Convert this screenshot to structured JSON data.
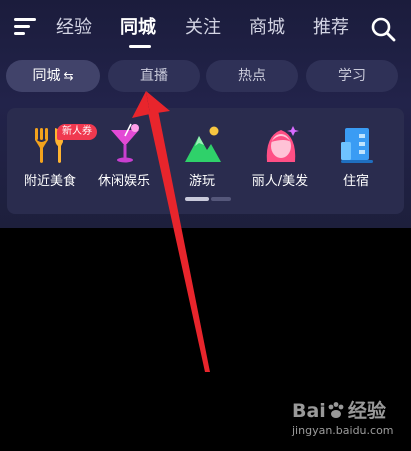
{
  "header": {
    "tabs": [
      {
        "label": "经验",
        "active": false
      },
      {
        "label": "同城",
        "active": true
      },
      {
        "label": "关注",
        "active": false
      },
      {
        "label": "商城",
        "active": false
      },
      {
        "label": "推荐",
        "active": false
      }
    ],
    "menu_icon": "hamburger-menu-icon",
    "search_icon": "search-icon"
  },
  "sub_tabs": [
    {
      "label": "同城",
      "suffix": "⇆",
      "active": true
    },
    {
      "label": "直播",
      "active": false
    },
    {
      "label": "热点",
      "active": false
    },
    {
      "label": "学习",
      "active": false
    }
  ],
  "categories": [
    {
      "label": "附近美食",
      "icon": "fork-knife-icon",
      "badge": "新人券",
      "color": "#f3a21d"
    },
    {
      "label": "休闲娱乐",
      "icon": "cocktail-icon",
      "color": "#e34ad5"
    },
    {
      "label": "游玩",
      "icon": "mountain-icon",
      "color": "#2fd16a"
    },
    {
      "label": "丽人/美发",
      "icon": "woman-head-icon",
      "color": "#ff5a8c"
    },
    {
      "label": "住宿",
      "icon": "hotel-building-icon",
      "color": "#3a9cf4"
    }
  ],
  "carousel": {
    "page": 1,
    "pages": 2
  },
  "annotation": {
    "arrow_color": "#e8252c"
  },
  "watermark": {
    "brand_left": "Bai",
    "brand_right": "经验",
    "url": "jingyan.baidu.com"
  },
  "colors": {
    "background": "#000000",
    "panel": "#2a2c4e",
    "header_bg": "#1e1f40"
  }
}
